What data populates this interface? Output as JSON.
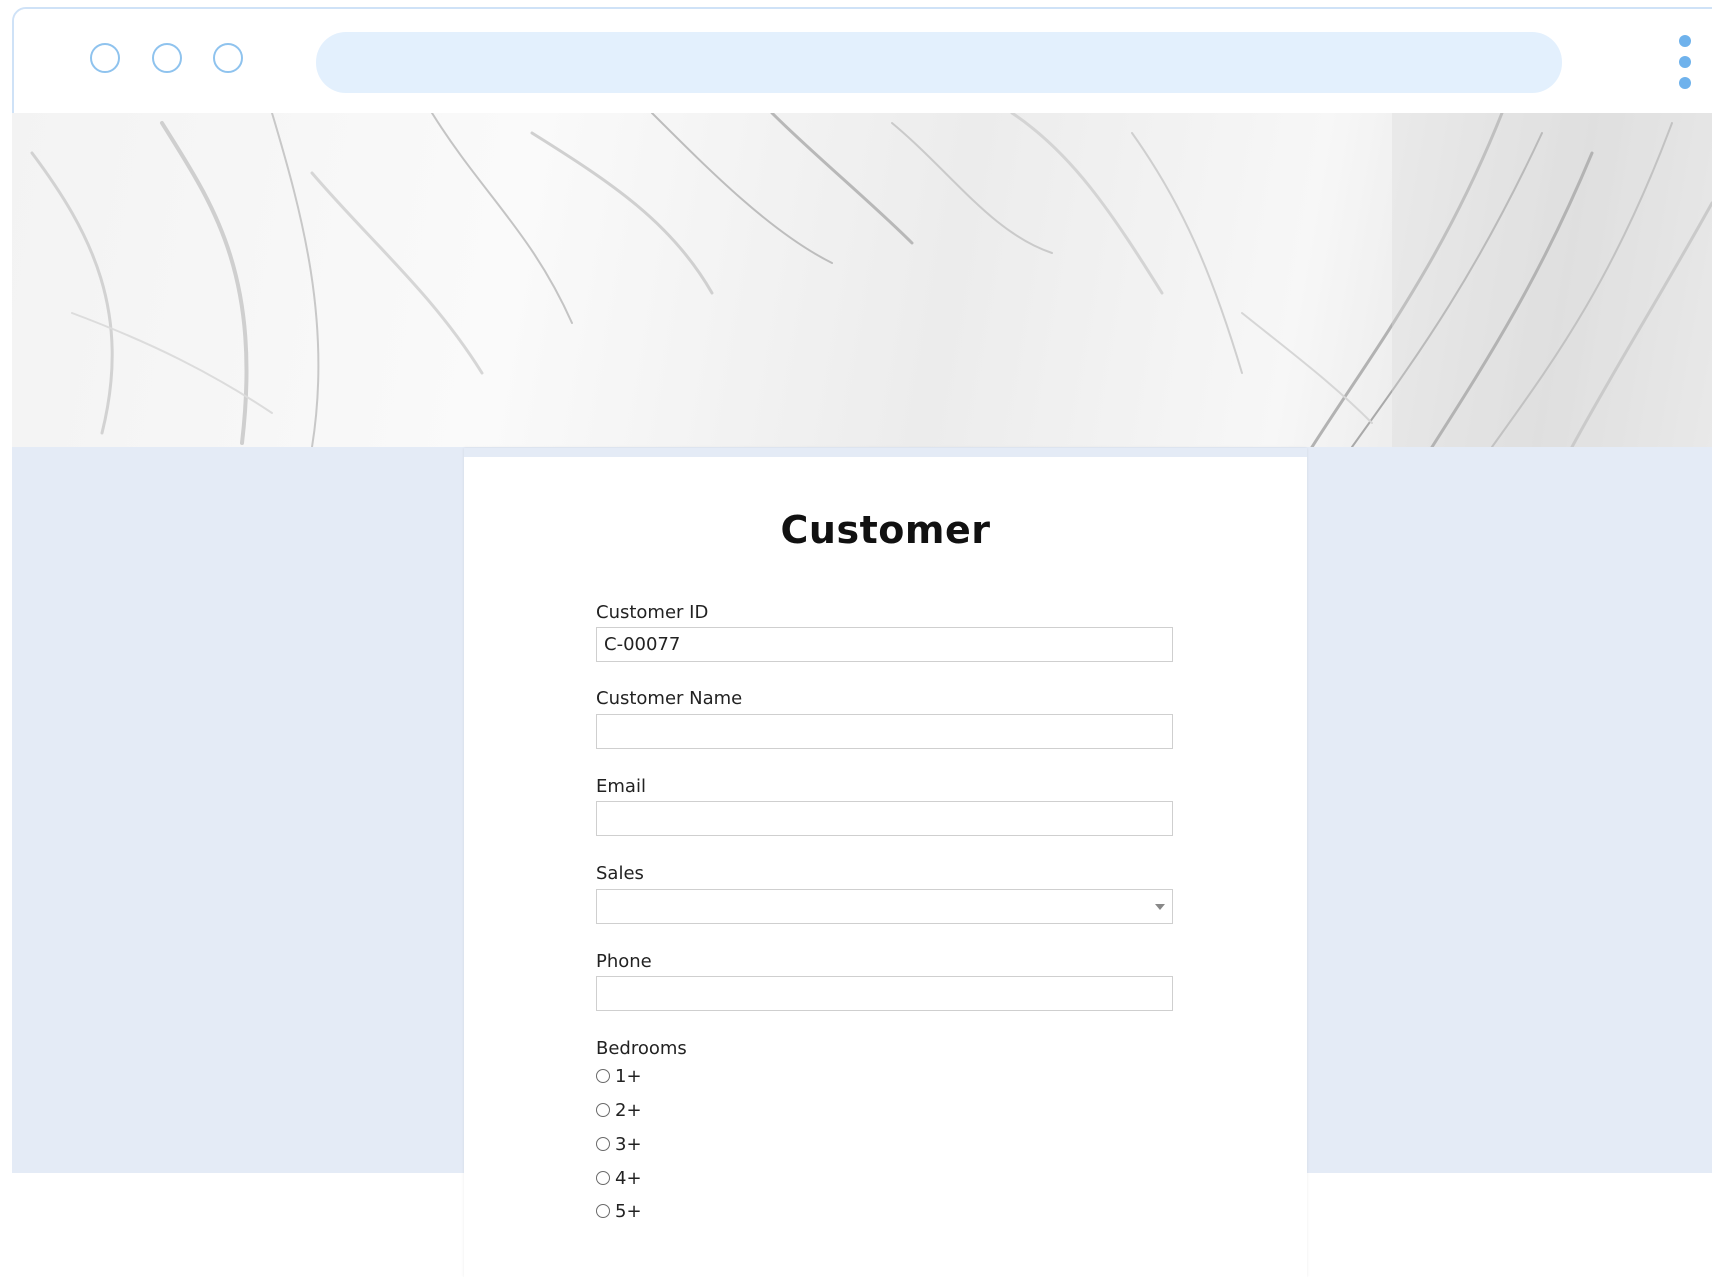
{
  "form": {
    "title": "Customer",
    "fields": {
      "customer_id": {
        "label": "Customer ID",
        "value": "C-00077"
      },
      "customer_name": {
        "label": "Customer Name",
        "value": ""
      },
      "email": {
        "label": "Email",
        "value": ""
      },
      "sales": {
        "label": "Sales",
        "selected": ""
      },
      "phone": {
        "label": "Phone",
        "value": ""
      },
      "bedrooms": {
        "label": "Bedrooms",
        "options": [
          "1+",
          "2+",
          "3+",
          "4+",
          "5+"
        ]
      }
    }
  },
  "icons": {
    "window_buttons": [
      "window-control-icon",
      "window-control-icon",
      "window-control-icon"
    ],
    "menu": "kebab-menu-icon",
    "select": "chevron-down-icon"
  },
  "colors": {
    "browser_accent": "#8fc3ee",
    "address_bar": "#e3f0fd",
    "page_background": "#e4ebf6"
  }
}
